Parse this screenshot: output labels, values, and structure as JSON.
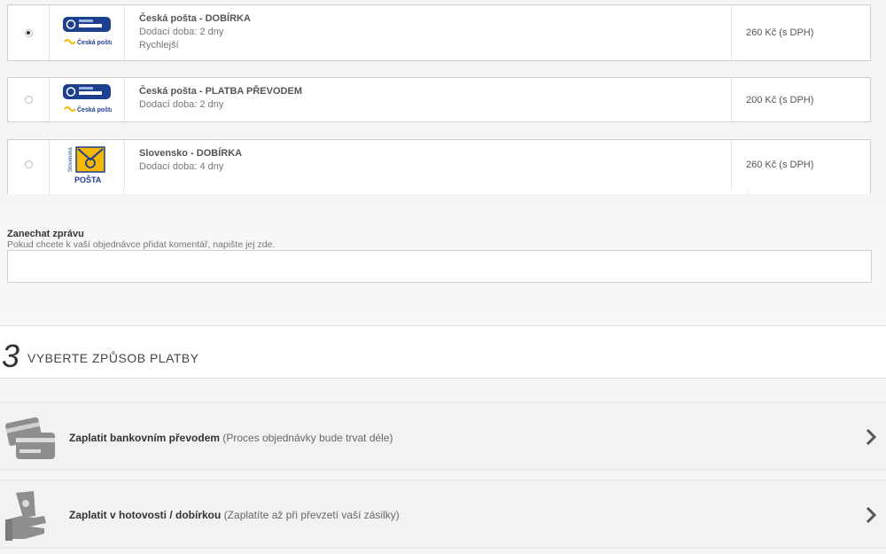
{
  "shipping_options": [
    {
      "logo": "balik-do-ruky-logo",
      "logo_brand": "Česká pošta",
      "name": "Česká pošta - DOBÍRKA",
      "delivery": "Dodací doba: 2 dny",
      "extra": "Rychlejší",
      "price": "260 Kč (s DPH)",
      "selected": true
    },
    {
      "logo": "balik-do-ruky-logo",
      "logo_brand": "Česká pošta",
      "name": "Česká pošta - PLATBA PŘEVODEM",
      "delivery": "Dodací doba: 2 dny",
      "extra": "",
      "price": "200 Kč (s DPH)",
      "selected": false
    },
    {
      "logo": "slovenska-posta-logo",
      "logo_brand": "Slovenská POŠTA",
      "name": "Slovensko - DOBÍRKA",
      "delivery": "Dodací doba: 4 dny",
      "extra": "",
      "price": "260 Kč (s DPH)",
      "selected": false
    }
  ],
  "message": {
    "label": "Zanechat zprávu",
    "hint": "Pokud chcete k vaší objednávce přidat komentář, napište jej zde.",
    "value": ""
  },
  "payment_section": {
    "number": "3",
    "title": "VYBERTE ZPŮSOB PLATBY"
  },
  "payment_options": [
    {
      "icon": "credit-card-icon",
      "main": "Zaplatit bankovním převodem",
      "note": "(Proces objednávky bude trvat déle)"
    },
    {
      "icon": "cash-hand-icon",
      "main": "Zaplatit v hotovosti / dobírkou",
      "note": "(Zaplatíte až při převzetí vaší zásilky)"
    }
  ],
  "colors": {
    "accent_blue": "#1d3f8f",
    "posta_yellow": "#f5b800"
  }
}
